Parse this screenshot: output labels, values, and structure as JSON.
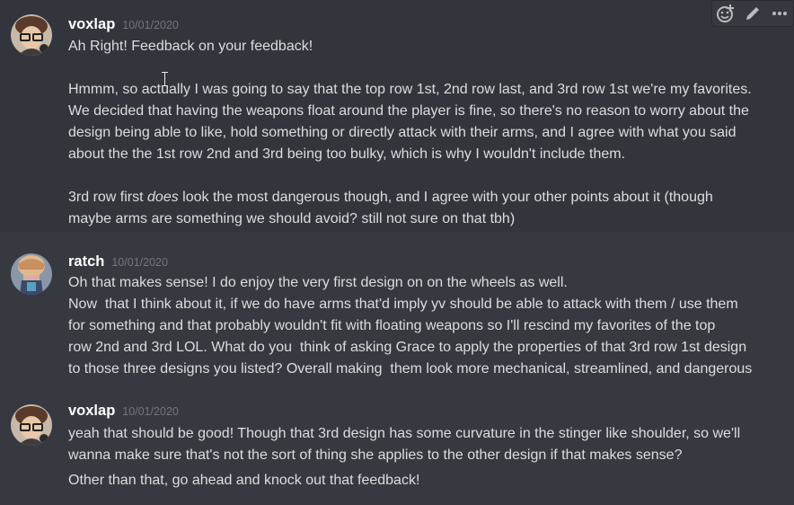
{
  "messages": [
    {
      "username": "voxlap",
      "timestamp": "10/01/2020",
      "lines": [
        "Ah Right! Feedback on your feedback!",
        "Hmmm, so actually I was going to say that the top row 1st, 2nd row last, and 3rd row 1st we're my favorites.",
        "We decided that having the weapons float around the player is fine, so there's no reason to worry about the",
        "design being able to like, hold something or directly attack with their arms, and I agree with what you said",
        "about the the 1st row 2nd and 3rd being too bulky, which is why I wouldn't include them.",
        "3rd row first ",
        "does",
        " look the most dangerous though, and I agree with your other points about it (though",
        "maybe arms are something we should avoid? still not sure on that tbh)"
      ]
    },
    {
      "username": "ratch",
      "timestamp": "10/01/2020",
      "lines": [
        "Oh that makes sense! I do enjoy the very first design on on the wheels as well.",
        "Now  that I think about it, if we do have arms that'd imply yv should be able to attack with them / use them",
        "for something and that probably wouldn't fit with floating weapons so I'll rescind my favorites of the top",
        "row 2nd and 3rd LOL. What do you  think of asking Grace to apply the properties of that 3rd row 1st design",
        "to those three designs you listed? Overall making  them look more mechanical, streamlined, and dangerous"
      ]
    },
    {
      "username": "voxlap",
      "timestamp": "10/01/2020",
      "lines": [
        "yeah that should be good! Though that 3rd design has some curvature in the stinger like shoulder, so we'll",
        "wanna make sure that's not the sort of thing she applies to the other design if that makes sense?",
        "Other than that, go ahead and knock out that feedback!"
      ]
    }
  ],
  "toolbar": {
    "icons": [
      "add-reaction-icon",
      "edit-icon",
      "more-options-icon"
    ]
  },
  "colors": {
    "background": "#36393f",
    "hover_background": "#32353b",
    "text": "#dcddde",
    "username": "#ffffff",
    "timestamp": "#72767d",
    "icon": "#b9bbbe"
  }
}
